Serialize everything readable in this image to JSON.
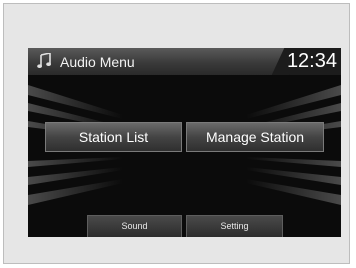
{
  "header": {
    "title": "Audio Menu",
    "clock": "12:34",
    "music_icon": "music-note-icon"
  },
  "main_buttons": {
    "station_list": "Station List",
    "manage_station": "Manage Station"
  },
  "bottom_tabs": {
    "sound": "Sound",
    "setting": "Setting"
  },
  "colors": {
    "screen_background": "#0b0b0b",
    "frame_background": "#e6e6e6",
    "text": "#ffffff"
  }
}
